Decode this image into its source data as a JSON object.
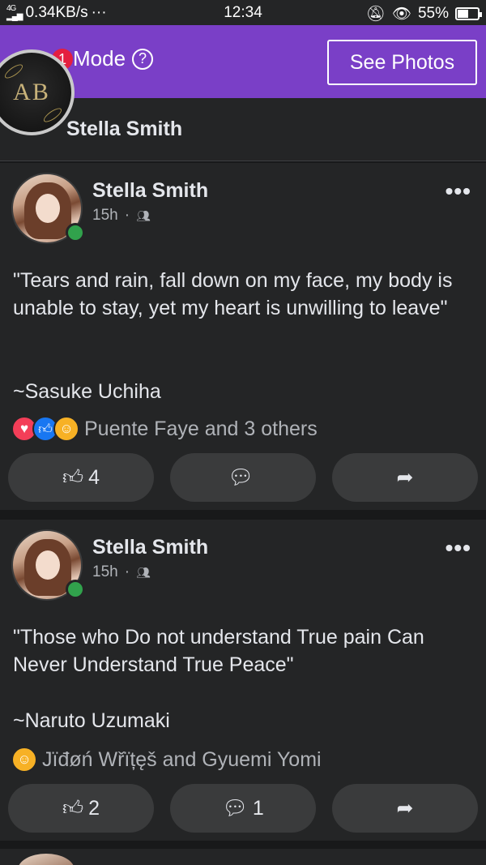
{
  "status_bar": {
    "network": "0.34KB/s",
    "dots": "···",
    "time": "12:34",
    "battery": "55%",
    "battery_level": 0.55
  },
  "header": {
    "notification_count": "1",
    "mode_label": "Mode",
    "help_glyph": "?",
    "see_photos_label": "See Photos",
    "accent_color": "#7a3fc7"
  },
  "page": {
    "logo_text": "AB",
    "name": "Stella Smith"
  },
  "posts": [
    {
      "author": "Stella Smith",
      "time": "15h",
      "audience_icon": "friends-icon",
      "text": "\"Tears and rain, fall down on my face, my body is unable to stay, yet my heart is unwilling to leave\"",
      "signature": "~Sasuke Uchiha",
      "reactions": [
        "love",
        "like",
        "care"
      ],
      "reaction_names": "Puente Faye and 3 others",
      "like_count": "4",
      "comment_count": ""
    },
    {
      "author": "Stella Smith",
      "time": "15h",
      "audience_icon": "friends-icon",
      "text": "\"Those who Do not understand True pain Can Never Understand True Peace\"",
      "signature": "~Naruto Uzumaki",
      "reactions": [
        "care"
      ],
      "reaction_names": "Jïđøń Wřïțęš and Gyuemi Yomi",
      "like_count": "2",
      "comment_count": "1"
    }
  ]
}
